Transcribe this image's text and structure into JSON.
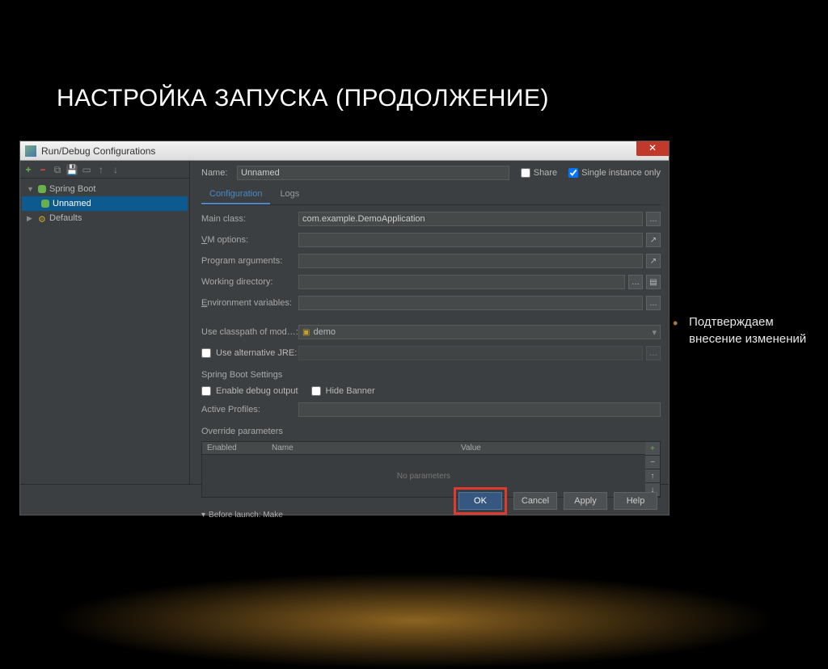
{
  "slide": {
    "title": "НАСТРОЙКА ЗАПУСКА (ПРОДОЛЖЕНИЕ)",
    "bullet": "Подтверждаем внесение изменений"
  },
  "window": {
    "title": "Run/Debug Configurations",
    "tree": {
      "root": "Spring Boot",
      "selected": "Unnamed",
      "defaults": "Defaults"
    },
    "name_label": "Name:",
    "name_value": "Unnamed",
    "share": "Share",
    "single_instance": "Single instance only",
    "tabs": {
      "config": "Configuration",
      "logs": "Logs"
    },
    "fields": {
      "main_class": "Main class:",
      "main_class_val": "com.example.DemoApplication",
      "vm_options": "VM options:",
      "program_args": "Program arguments:",
      "working_dir": "Working directory:",
      "env_vars": "Environment variables:",
      "classpath": "Use classpath of mod…:",
      "classpath_val": "demo",
      "alt_jre": "Use alternative JRE:"
    },
    "spring": {
      "settings_label": "Spring Boot Settings",
      "enable_debug": "Enable debug output",
      "hide_banner": "Hide Banner",
      "active_profiles": "Active Profiles:",
      "override_params": "Override parameters",
      "col_enabled": "Enabled",
      "col_name": "Name",
      "col_value": "Value",
      "no_params": "No parameters"
    },
    "before_launch": "Before launch: Make",
    "buttons": {
      "ok": "OK",
      "cancel": "Cancel",
      "apply": "Apply",
      "help": "Help"
    }
  }
}
